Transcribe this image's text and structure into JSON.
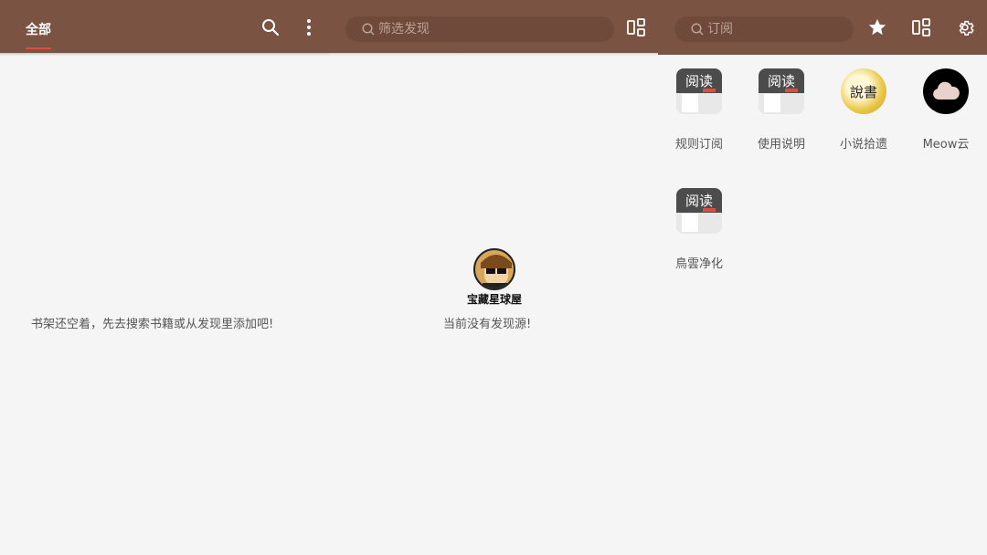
{
  "bookshelf": {
    "tab_all": "全部",
    "empty_message": "书架还空着，先去搜索书籍或从发现里添加吧!"
  },
  "discover": {
    "search_placeholder": "筛选发现",
    "empty_message": "当前没有发现源!"
  },
  "rss": {
    "search_placeholder": "订阅",
    "items": [
      {
        "label": "规则订阅",
        "icon": "read-app-icon"
      },
      {
        "label": "使用说明",
        "icon": "read-app-icon"
      },
      {
        "label": "小说拾遗",
        "icon": "gold-seal-icon"
      },
      {
        "label": "Meow云",
        "icon": "cloud-icon"
      },
      {
        "label": "鳥雲净化",
        "icon": "read-app-icon"
      }
    ],
    "read_icon_text": "阅读",
    "gold_icon_text": "說書"
  },
  "watermark": {
    "text": "宝藏星球屋"
  },
  "colors": {
    "toolbar": "#7a5342",
    "accent": "#e14a3f",
    "background": "#f5f5f5"
  }
}
